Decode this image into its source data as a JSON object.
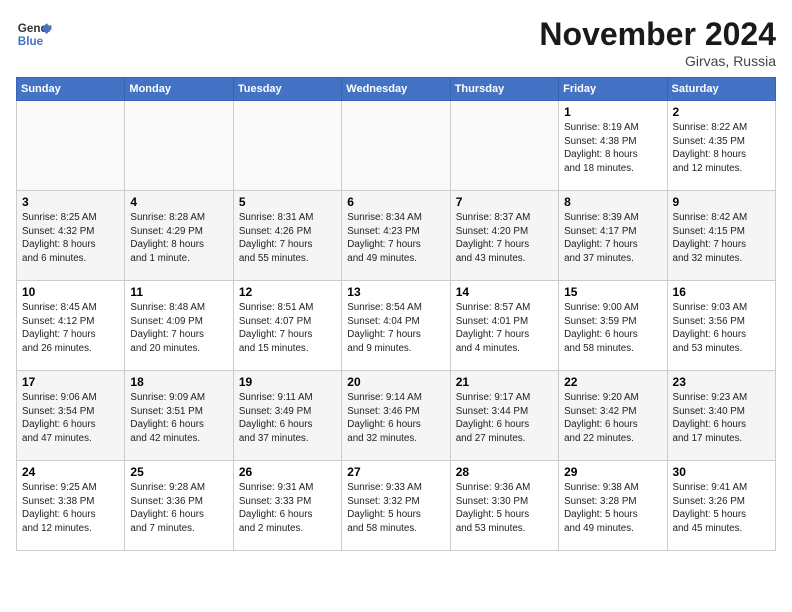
{
  "header": {
    "logo_line1": "General",
    "logo_line2": "Blue",
    "month_title": "November 2024",
    "location": "Girvas, Russia"
  },
  "weekdays": [
    "Sunday",
    "Monday",
    "Tuesday",
    "Wednesday",
    "Thursday",
    "Friday",
    "Saturday"
  ],
  "weeks": [
    [
      {
        "day": "",
        "info": ""
      },
      {
        "day": "",
        "info": ""
      },
      {
        "day": "",
        "info": ""
      },
      {
        "day": "",
        "info": ""
      },
      {
        "day": "",
        "info": ""
      },
      {
        "day": "1",
        "info": "Sunrise: 8:19 AM\nSunset: 4:38 PM\nDaylight: 8 hours\nand 18 minutes."
      },
      {
        "day": "2",
        "info": "Sunrise: 8:22 AM\nSunset: 4:35 PM\nDaylight: 8 hours\nand 12 minutes."
      }
    ],
    [
      {
        "day": "3",
        "info": "Sunrise: 8:25 AM\nSunset: 4:32 PM\nDaylight: 8 hours\nand 6 minutes."
      },
      {
        "day": "4",
        "info": "Sunrise: 8:28 AM\nSunset: 4:29 PM\nDaylight: 8 hours\nand 1 minute."
      },
      {
        "day": "5",
        "info": "Sunrise: 8:31 AM\nSunset: 4:26 PM\nDaylight: 7 hours\nand 55 minutes."
      },
      {
        "day": "6",
        "info": "Sunrise: 8:34 AM\nSunset: 4:23 PM\nDaylight: 7 hours\nand 49 minutes."
      },
      {
        "day": "7",
        "info": "Sunrise: 8:37 AM\nSunset: 4:20 PM\nDaylight: 7 hours\nand 43 minutes."
      },
      {
        "day": "8",
        "info": "Sunrise: 8:39 AM\nSunset: 4:17 PM\nDaylight: 7 hours\nand 37 minutes."
      },
      {
        "day": "9",
        "info": "Sunrise: 8:42 AM\nSunset: 4:15 PM\nDaylight: 7 hours\nand 32 minutes."
      }
    ],
    [
      {
        "day": "10",
        "info": "Sunrise: 8:45 AM\nSunset: 4:12 PM\nDaylight: 7 hours\nand 26 minutes."
      },
      {
        "day": "11",
        "info": "Sunrise: 8:48 AM\nSunset: 4:09 PM\nDaylight: 7 hours\nand 20 minutes."
      },
      {
        "day": "12",
        "info": "Sunrise: 8:51 AM\nSunset: 4:07 PM\nDaylight: 7 hours\nand 15 minutes."
      },
      {
        "day": "13",
        "info": "Sunrise: 8:54 AM\nSunset: 4:04 PM\nDaylight: 7 hours\nand 9 minutes."
      },
      {
        "day": "14",
        "info": "Sunrise: 8:57 AM\nSunset: 4:01 PM\nDaylight: 7 hours\nand 4 minutes."
      },
      {
        "day": "15",
        "info": "Sunrise: 9:00 AM\nSunset: 3:59 PM\nDaylight: 6 hours\nand 58 minutes."
      },
      {
        "day": "16",
        "info": "Sunrise: 9:03 AM\nSunset: 3:56 PM\nDaylight: 6 hours\nand 53 minutes."
      }
    ],
    [
      {
        "day": "17",
        "info": "Sunrise: 9:06 AM\nSunset: 3:54 PM\nDaylight: 6 hours\nand 47 minutes."
      },
      {
        "day": "18",
        "info": "Sunrise: 9:09 AM\nSunset: 3:51 PM\nDaylight: 6 hours\nand 42 minutes."
      },
      {
        "day": "19",
        "info": "Sunrise: 9:11 AM\nSunset: 3:49 PM\nDaylight: 6 hours\nand 37 minutes."
      },
      {
        "day": "20",
        "info": "Sunrise: 9:14 AM\nSunset: 3:46 PM\nDaylight: 6 hours\nand 32 minutes."
      },
      {
        "day": "21",
        "info": "Sunrise: 9:17 AM\nSunset: 3:44 PM\nDaylight: 6 hours\nand 27 minutes."
      },
      {
        "day": "22",
        "info": "Sunrise: 9:20 AM\nSunset: 3:42 PM\nDaylight: 6 hours\nand 22 minutes."
      },
      {
        "day": "23",
        "info": "Sunrise: 9:23 AM\nSunset: 3:40 PM\nDaylight: 6 hours\nand 17 minutes."
      }
    ],
    [
      {
        "day": "24",
        "info": "Sunrise: 9:25 AM\nSunset: 3:38 PM\nDaylight: 6 hours\nand 12 minutes."
      },
      {
        "day": "25",
        "info": "Sunrise: 9:28 AM\nSunset: 3:36 PM\nDaylight: 6 hours\nand 7 minutes."
      },
      {
        "day": "26",
        "info": "Sunrise: 9:31 AM\nSunset: 3:33 PM\nDaylight: 6 hours\nand 2 minutes."
      },
      {
        "day": "27",
        "info": "Sunrise: 9:33 AM\nSunset: 3:32 PM\nDaylight: 5 hours\nand 58 minutes."
      },
      {
        "day": "28",
        "info": "Sunrise: 9:36 AM\nSunset: 3:30 PM\nDaylight: 5 hours\nand 53 minutes."
      },
      {
        "day": "29",
        "info": "Sunrise: 9:38 AM\nSunset: 3:28 PM\nDaylight: 5 hours\nand 49 minutes."
      },
      {
        "day": "30",
        "info": "Sunrise: 9:41 AM\nSunset: 3:26 PM\nDaylight: 5 hours\nand 45 minutes."
      }
    ]
  ]
}
